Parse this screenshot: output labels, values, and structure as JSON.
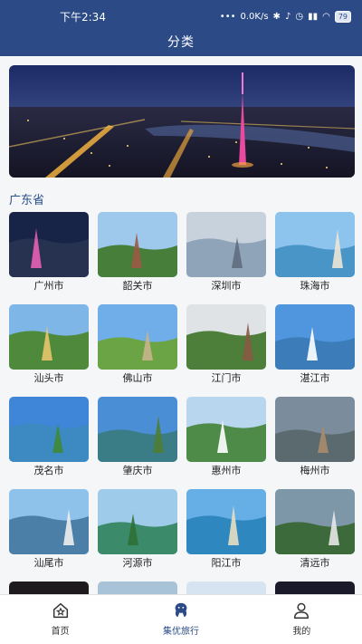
{
  "status_bar": {
    "time": "下午2:34",
    "network_speed": "0.0K/s",
    "battery": "79"
  },
  "header": {
    "title": "分类"
  },
  "section": {
    "province": "广东省"
  },
  "cities": [
    {
      "name": "广州市",
      "sky": "#182447",
      "ground": "#26324f",
      "accent": "#e85fb2"
    },
    {
      "name": "韶关市",
      "sky": "#9ec8ec",
      "ground": "#477f3a",
      "accent": "#9a5a45"
    },
    {
      "name": "深圳市",
      "sky": "#c8d2dd",
      "ground": "#8fa3b9",
      "accent": "#5e6e80"
    },
    {
      "name": "珠海市",
      "sky": "#8cc4ee",
      "ground": "#4a95c8",
      "accent": "#ece6d6"
    },
    {
      "name": "汕头市",
      "sky": "#7eb6e8",
      "ground": "#4f8a3c",
      "accent": "#e8c56a"
    },
    {
      "name": "佛山市",
      "sky": "#6faee8",
      "ground": "#6aa444",
      "accent": "#c9b48c"
    },
    {
      "name": "江门市",
      "sky": "#dfe3e6",
      "ground": "#4d7e3a",
      "accent": "#8a5a44"
    },
    {
      "name": "湛江市",
      "sky": "#4f96de",
      "ground": "#3b7cb9",
      "accent": "#ffffff"
    },
    {
      "name": "茂名市",
      "sky": "#3f86d8",
      "ground": "#3d89c2",
      "accent": "#3f8a3a"
    },
    {
      "name": "肇庆市",
      "sky": "#4a8fd6",
      "ground": "#3b7d86",
      "accent": "#4f7d35"
    },
    {
      "name": "惠州市",
      "sky": "#b9d6ef",
      "ground": "#4e8b48",
      "accent": "#ffffff"
    },
    {
      "name": "梅州市",
      "sky": "#7b8d9d",
      "ground": "#5b6a6e",
      "accent": "#a88b6b"
    },
    {
      "name": "汕尾市",
      "sky": "#8fc2ea",
      "ground": "#4c7fa8",
      "accent": "#eeeeee"
    },
    {
      "name": "河源市",
      "sky": "#9fcbea",
      "ground": "#3b8a6a",
      "accent": "#2f6f35"
    },
    {
      "name": "阳江市",
      "sky": "#66aee6",
      "ground": "#2e88bf",
      "accent": "#e8dfc2"
    },
    {
      "name": "清远市",
      "sky": "#7e97a8",
      "ground": "#3d6a3a",
      "accent": "#e8e8e8"
    },
    {
      "name": "",
      "sky": "#1e1a1e",
      "ground": "#3a2b28",
      "accent": "#d24a2a"
    },
    {
      "name": "",
      "sky": "#a8c2d8",
      "ground": "#4f5c5a",
      "accent": "#2f2f2f"
    },
    {
      "name": "",
      "sky": "#d6e4f2",
      "ground": "#7e8a7a",
      "accent": "#555555"
    },
    {
      "name": "",
      "sky": "#1b1a2a",
      "ground": "#4e2f22",
      "accent": "#ff9a3a"
    }
  ],
  "tabs": [
    {
      "label": "首页",
      "icon": "star-house-icon"
    },
    {
      "label": "集优旅行",
      "icon": "travel-icon"
    },
    {
      "label": "我的",
      "icon": "person-icon"
    }
  ],
  "colors": {
    "header": "#2b4a86",
    "province_text": "#2a4f8a",
    "active_tab": "#2b4a86"
  }
}
